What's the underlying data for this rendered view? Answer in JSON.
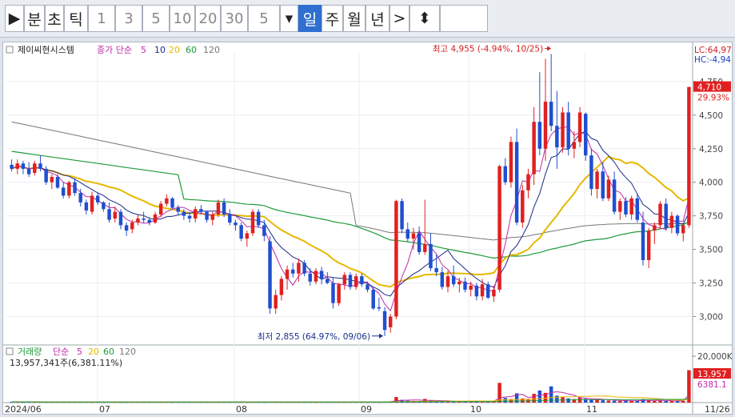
{
  "toolbar": {
    "items": [
      {
        "id": "play",
        "label": "▶",
        "kind": "icon"
      },
      {
        "id": "min",
        "label": "분"
      },
      {
        "id": "sec",
        "label": "초"
      },
      {
        "id": "tick",
        "label": "틱"
      },
      {
        "id": "n1",
        "label": "1",
        "num": true
      },
      {
        "id": "n3",
        "label": "3",
        "num": true
      },
      {
        "id": "n5",
        "label": "5",
        "num": true
      },
      {
        "id": "n10",
        "label": "10",
        "num": true
      },
      {
        "id": "n20",
        "label": "20",
        "num": true
      },
      {
        "id": "n30",
        "label": "30",
        "num": true
      },
      {
        "id": "period_value",
        "label": "5",
        "num": true
      },
      {
        "id": "dropdown",
        "label": "▾",
        "kind": "icon"
      },
      {
        "id": "day",
        "label": "일",
        "active": true
      },
      {
        "id": "week",
        "label": "주"
      },
      {
        "id": "month",
        "label": "월"
      },
      {
        "id": "year",
        "label": "년"
      },
      {
        "id": "next",
        "label": ">",
        "kind": "icon"
      },
      {
        "id": "updown",
        "label": "⬍",
        "kind": "icon"
      },
      {
        "id": "input",
        "label": ""
      }
    ]
  },
  "chart": {
    "stock_name": "제이씨현시스템",
    "ma_label": "종가 단순",
    "ma_periods": [
      "5",
      "10",
      "20",
      "60",
      "120"
    ],
    "lc_label": "LC:64,97",
    "hc_label": "HC:-4,94",
    "high_annotation": "최고 4,955 (-4.94%, 10/25)",
    "low_annotation": "최저 2,855 (64.97%, 09/06)",
    "current_price_label": "4,710",
    "current_change_label": "29.93%",
    "price_ticks": [
      "4,750",
      "4,500",
      "4,250",
      "4,000",
      "3,750",
      "3,500",
      "3,250",
      "3,000"
    ],
    "date_labels": [
      "2024/06",
      "07",
      "08",
      "09",
      "10",
      "11",
      "11/26"
    ],
    "volume_title": "거래량",
    "volume_ma_label": "단순",
    "volume_ma_periods": [
      "5",
      "20",
      "60",
      "120"
    ],
    "volume_value": "13,957,341주(6,381.11%)",
    "volume_ticks": [
      "20,000K"
    ],
    "volume_current_label": "13,957",
    "volume_ma_current_label": "6381.1",
    "colors": {
      "up": "#e02020",
      "down": "#1f4fd0",
      "ma5": "#c02aa8",
      "ma10": "#1a2a8a",
      "ma20": "#e6b800",
      "ma60": "#1e9a3a",
      "ma120": "#777777"
    }
  },
  "chart_data": {
    "type": "candlestick",
    "ylim": [
      2800,
      4970
    ],
    "candles": [
      [
        4130,
        4170,
        4080,
        4100
      ],
      [
        4100,
        4170,
        4060,
        4140
      ],
      [
        4140,
        4160,
        4060,
        4100
      ],
      [
        4100,
        4150,
        4040,
        4060
      ],
      [
        4070,
        4160,
        4050,
        4140
      ],
      [
        4140,
        4200,
        4080,
        4100
      ],
      [
        4100,
        4120,
        3980,
        4000
      ],
      [
        4000,
        4060,
        3950,
        4040
      ],
      [
        4040,
        4060,
        3950,
        3960
      ],
      [
        3960,
        4000,
        3880,
        3900
      ],
      [
        3900,
        4010,
        3880,
        4000
      ],
      [
        4000,
        4030,
        3900,
        3920
      ],
      [
        3920,
        3950,
        3820,
        3850
      ],
      [
        3850,
        3870,
        3760,
        3790
      ],
      [
        3780,
        3930,
        3760,
        3900
      ],
      [
        3900,
        3920,
        3830,
        3850
      ],
      [
        3850,
        3860,
        3780,
        3800
      ],
      [
        3800,
        3850,
        3700,
        3720
      ],
      [
        3730,
        3820,
        3700,
        3780
      ],
      [
        3780,
        3800,
        3650,
        3680
      ],
      [
        3680,
        3700,
        3600,
        3640
      ],
      [
        3650,
        3720,
        3620,
        3700
      ],
      [
        3700,
        3760,
        3680,
        3730
      ],
      [
        3730,
        3780,
        3700,
        3720
      ],
      [
        3720,
        3740,
        3680,
        3700
      ],
      [
        3700,
        3780,
        3690,
        3760
      ],
      [
        3760,
        3860,
        3740,
        3840
      ],
      [
        3840,
        3910,
        3820,
        3880
      ],
      [
        3880,
        3890,
        3800,
        3810
      ],
      [
        3810,
        3830,
        3760,
        3780
      ],
      [
        3780,
        3800,
        3720,
        3750
      ],
      [
        3750,
        3780,
        3700,
        3730
      ],
      [
        3730,
        3820,
        3700,
        3800
      ],
      [
        3800,
        3830,
        3760,
        3780
      ],
      [
        3780,
        3790,
        3700,
        3720
      ],
      [
        3720,
        3780,
        3680,
        3760
      ],
      [
        3760,
        3870,
        3740,
        3850
      ],
      [
        3850,
        3880,
        3740,
        3760
      ],
      [
        3760,
        3800,
        3680,
        3700
      ],
      [
        3700,
        3720,
        3640,
        3680
      ],
      [
        3680,
        3700,
        3560,
        3580
      ],
      [
        3580,
        3640,
        3520,
        3620
      ],
      [
        3620,
        3800,
        3600,
        3780
      ],
      [
        3780,
        3800,
        3660,
        3680
      ],
      [
        3680,
        3720,
        3560,
        3600
      ],
      [
        3560,
        3600,
        3020,
        3060
      ],
      [
        3060,
        3200,
        3020,
        3160
      ],
      [
        3160,
        3300,
        3120,
        3280
      ],
      [
        3280,
        3380,
        3200,
        3350
      ],
      [
        3350,
        3400,
        3290,
        3320
      ],
      [
        3320,
        3430,
        3260,
        3400
      ],
      [
        3400,
        3420,
        3300,
        3320
      ],
      [
        3320,
        3360,
        3230,
        3260
      ],
      [
        3260,
        3360,
        3240,
        3340
      ],
      [
        3340,
        3370,
        3240,
        3280
      ],
      [
        3280,
        3330,
        3240,
        3250
      ],
      [
        3250,
        3290,
        3060,
        3100
      ],
      [
        3100,
        3250,
        3080,
        3240
      ],
      [
        3240,
        3330,
        3200,
        3310
      ],
      [
        3310,
        3330,
        3200,
        3220
      ],
      [
        3220,
        3320,
        3200,
        3300
      ],
      [
        3300,
        3320,
        3220,
        3240
      ],
      [
        3240,
        3260,
        3180,
        3200
      ],
      [
        3200,
        3220,
        3050,
        3060
      ],
      [
        3070,
        3140,
        3040,
        3060
      ],
      [
        3040,
        3070,
        2855,
        2900
      ],
      [
        2920,
        3020,
        2880,
        3000
      ],
      [
        3000,
        3870,
        2980,
        3860
      ],
      [
        3860,
        3880,
        3620,
        3650
      ],
      [
        3650,
        3700,
        3560,
        3580
      ],
      [
        3580,
        3660,
        3500,
        3620
      ],
      [
        3620,
        3670,
        3460,
        3480
      ],
      [
        3480,
        3870,
        3460,
        3540
      ],
      [
        3540,
        3620,
        3340,
        3360
      ],
      [
        3360,
        3460,
        3300,
        3330
      ],
      [
        3330,
        3370,
        3200,
        3220
      ],
      [
        3220,
        3340,
        3180,
        3300
      ],
      [
        3300,
        3380,
        3220,
        3240
      ],
      [
        3240,
        3290,
        3180,
        3260
      ],
      [
        3260,
        3290,
        3180,
        3200
      ],
      [
        3200,
        3260,
        3150,
        3230
      ],
      [
        3230,
        3250,
        3120,
        3150
      ],
      [
        3150,
        3280,
        3120,
        3240
      ],
      [
        3240,
        3260,
        3130,
        3140
      ],
      [
        3150,
        3230,
        3110,
        3200
      ],
      [
        3200,
        4130,
        3180,
        4120
      ],
      [
        4120,
        4180,
        3980,
        4000
      ],
      [
        4000,
        4340,
        3960,
        4300
      ],
      [
        4300,
        4400,
        3680,
        3700
      ],
      [
        3700,
        3980,
        3660,
        3940
      ],
      [
        3940,
        4100,
        3880,
        4060
      ],
      [
        4060,
        4560,
        3980,
        4450
      ],
      [
        4450,
        4820,
        4200,
        4250
      ],
      [
        4250,
        4920,
        4160,
        4600
      ],
      [
        4600,
        4955,
        4380,
        4420
      ],
      [
        4420,
        4680,
        4100,
        4260
      ],
      [
        4260,
        4560,
        4220,
        4520
      ],
      [
        4520,
        4600,
        4200,
        4250
      ],
      [
        4250,
        4380,
        4180,
        4300
      ],
      [
        4300,
        4560,
        4260,
        4520
      ],
      [
        4510,
        4520,
        4160,
        4200
      ],
      [
        4200,
        4250,
        3900,
        3950
      ],
      [
        3950,
        4100,
        3880,
        4080
      ],
      [
        4080,
        4150,
        3860,
        3880
      ],
      [
        3880,
        4050,
        3860,
        4020
      ],
      [
        4020,
        4080,
        3760,
        3780
      ],
      [
        3780,
        3880,
        3720,
        3860
      ],
      [
        3860,
        3890,
        3740,
        3760
      ],
      [
        3760,
        3900,
        3720,
        3880
      ],
      [
        3880,
        3910,
        3700,
        3720
      ],
      [
        3700,
        3780,
        3380,
        3420
      ],
      [
        3420,
        3660,
        3360,
        3640
      ],
      [
        3640,
        3700,
        3540,
        3680
      ],
      [
        3680,
        3860,
        3660,
        3840
      ],
      [
        3840,
        3880,
        3640,
        3660
      ],
      [
        3660,
        3780,
        3620,
        3750
      ],
      [
        3750,
        3760,
        3600,
        3620
      ],
      [
        3620,
        3700,
        3560,
        3680
      ],
      [
        3680,
        4710,
        3660,
        4710
      ]
    ],
    "volume": [
      300,
      300,
      280,
      300,
      290,
      270,
      280,
      290,
      300,
      270,
      280,
      260,
      270,
      300,
      280,
      260,
      270,
      300,
      280,
      270,
      260,
      300,
      280,
      270,
      290,
      300,
      270,
      280,
      260,
      280,
      290,
      270,
      300,
      260,
      280,
      300,
      270,
      260,
      280,
      300,
      290,
      280,
      300,
      270,
      260,
      340,
      300,
      280,
      270,
      300,
      290,
      280,
      260,
      270,
      300,
      280,
      300,
      270,
      260,
      280,
      300,
      260,
      280,
      300,
      270,
      380,
      450,
      2400,
      1200,
      800,
      700,
      600,
      1600,
      900,
      600,
      500,
      400,
      500,
      450,
      400,
      500,
      400,
      600,
      420,
      500,
      8500,
      2000,
      1500,
      4000,
      1800,
      1600,
      3800,
      5200,
      4200,
      7000,
      3000,
      2400,
      1800,
      1500,
      2200,
      1600,
      1400,
      1200,
      1000,
      900,
      800,
      700,
      900,
      700,
      800,
      1500,
      900,
      700,
      800,
      700,
      700,
      600,
      700,
      13957
    ]
  }
}
